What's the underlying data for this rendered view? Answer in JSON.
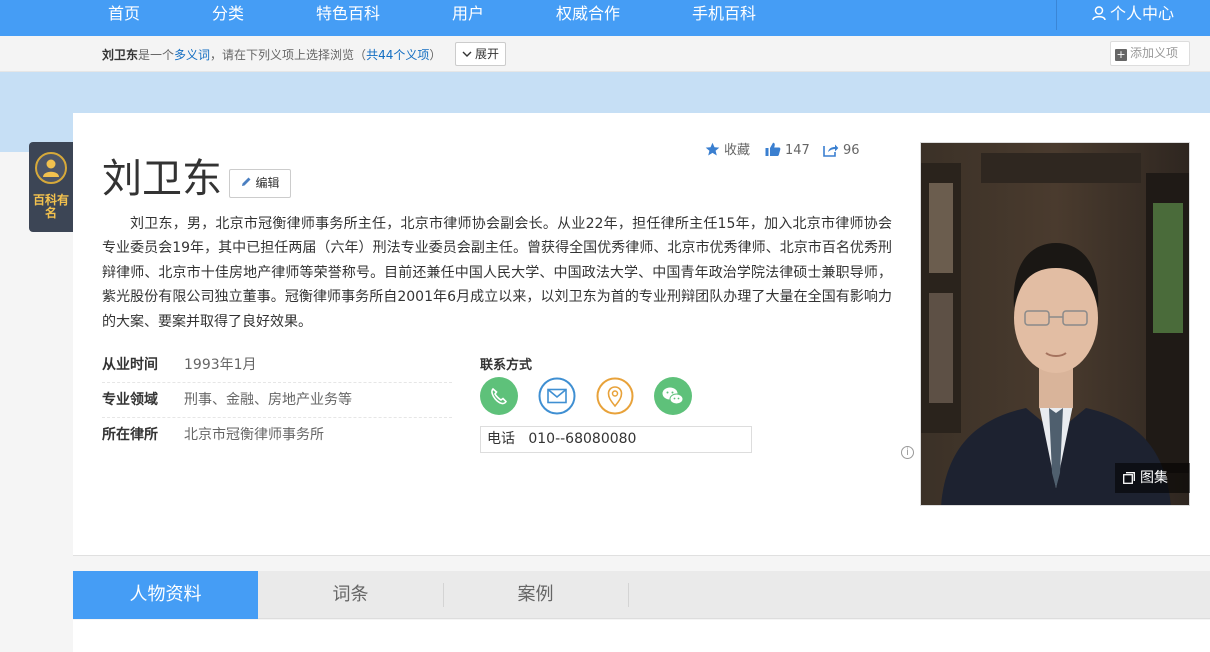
{
  "nav": {
    "items": [
      "首页",
      "分类",
      "特色百科",
      "用户",
      "权威合作",
      "手机百科"
    ],
    "user_center": "个人中心"
  },
  "polysemy": {
    "name": "刘卫东",
    "text_a": "是一个",
    "link_a": "多义词",
    "text_b": "，请在下列义项上选择浏览（",
    "link_b": "共44个义项",
    "text_c": "）",
    "expand_label": "展开",
    "add_label": "添加义项"
  },
  "badge": {
    "label": "百科有名"
  },
  "entry": {
    "title": "刘卫东",
    "edit_label": "编辑",
    "collect_label": "收藏",
    "like_count": "147",
    "share_count": "96",
    "summary": "刘卫东，男，北京市冠衡律师事务所主任，北京市律师协会副会长。从业22年，担任律所主任15年，加入北京市律师协会专业委员会19年，其中已担任两届（六年）刑法专业委员会副主任。曾获得全国优秀律师、北京市优秀律师、北京市百名优秀刑辩律师、北京市十佳房地产律师等荣誉称号。目前还兼任中国人民大学、中国政法大学、中国青年政治学院法律硕士兼职导师，紫光股份有限公司独立董事。冠衡律师事务所自2001年6月成立以来，以刘卫东为首的专业刑辩团队办理了大量在全国有影响力的大案、要案并取得了良好效果。"
  },
  "info": [
    {
      "key": "从业时间",
      "value": "1993年1月"
    },
    {
      "key": "专业领域",
      "value": "刑事、金融、房地产业务等"
    },
    {
      "key": "所在律所",
      "value": "北京市冠衡律师事务所"
    }
  ],
  "contact": {
    "title": "联系方式",
    "phone_label": "电话",
    "phone_value": "010--68080080",
    "colors": {
      "phone": "#5ec17a",
      "mail": "#3f8fd2",
      "location": "#e8a23a",
      "wechat": "#5ec17a"
    }
  },
  "gallery_label": "图集",
  "tabs": [
    "人物资料",
    "词条",
    "案例"
  ],
  "colors": {
    "brand_blue": "#459df5",
    "link_blue": "#136ec2"
  }
}
